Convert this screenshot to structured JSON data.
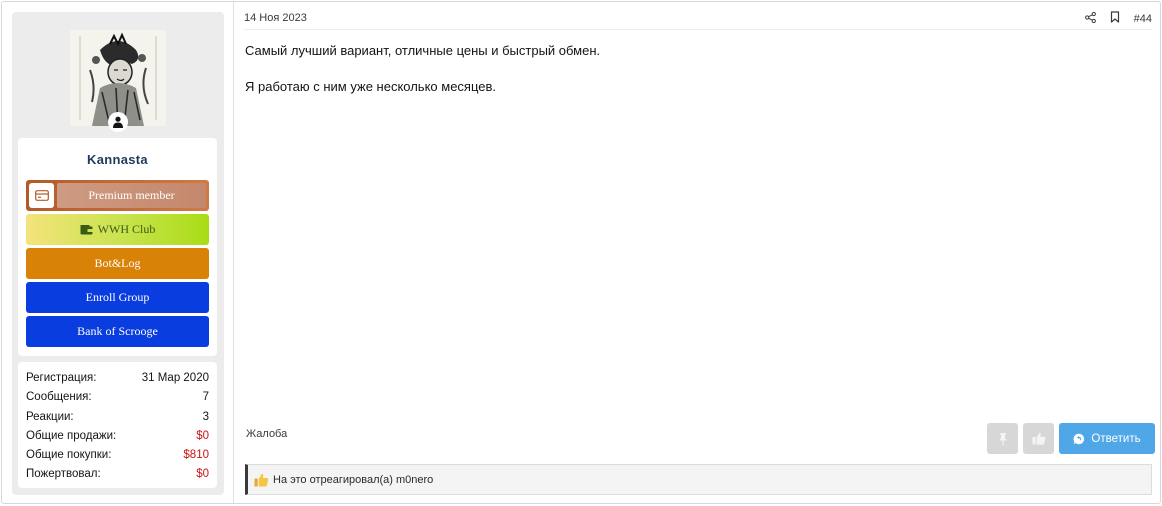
{
  "user": {
    "username": "Kannasta",
    "avatar_icon": "portrait-illustration-avatar",
    "online_icon": "person-icon",
    "banners": [
      {
        "label": "Premium member",
        "icon": "card-icon"
      },
      {
        "label": "WWH Club",
        "icon": "wallet-icon"
      },
      {
        "label": "Bot&Log"
      },
      {
        "label": "Enroll Group"
      },
      {
        "label": "Bank of Scrooge"
      }
    ],
    "stats": [
      {
        "label": "Регистрация:",
        "value": "31 Мар 2020"
      },
      {
        "label": "Сообщения:",
        "value": "7"
      },
      {
        "label": "Реакции:",
        "value": "3"
      },
      {
        "label": "Общие продажи:",
        "value": "$0"
      },
      {
        "label": "Общие покупки:",
        "value": "$810"
      },
      {
        "label": "Пожертвовал:",
        "value": "$0"
      }
    ]
  },
  "post": {
    "date": "14 Ноя 2023",
    "number": "#44",
    "share_icon": "share-icon",
    "bookmark_icon": "bookmark-icon",
    "message": [
      "Самый лучший вариант, отличные цены и быстрый обмен.",
      "Я работаю с ним уже несколько месяцев."
    ],
    "report_label": "Жалоба",
    "reply_label": "Ответить",
    "reactions_text": "На это отреагировал(а) m0nero"
  },
  "colors": {
    "accent_reply": "#4fa7e8",
    "money": "#cc1414",
    "username": "#1e3a5c",
    "premium": "#b35a2a",
    "bot": "#d98208",
    "blue_banner": "#0a3ddf"
  }
}
